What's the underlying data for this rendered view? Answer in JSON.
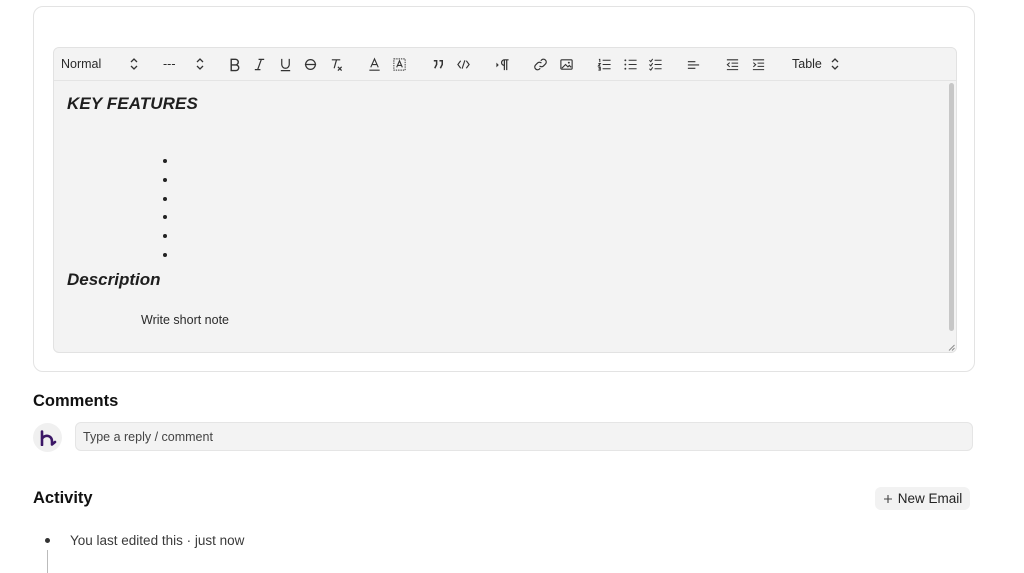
{
  "editor": {
    "toolbar": {
      "paragraph_style": "Normal",
      "font_size": "---",
      "table_label": "Table",
      "buttons": [
        "bold-icon",
        "italic-icon",
        "underline-icon",
        "strikethrough-icon",
        "clear-format-icon",
        "text-color-icon",
        "highlight-icon",
        "blockquote-icon",
        "code-icon",
        "paragraph-direction-icon",
        "link-icon",
        "image-icon",
        "ordered-list-icon",
        "bullet-list-icon",
        "checklist-icon",
        "align-left-icon",
        "outdent-icon",
        "indent-icon"
      ]
    },
    "heading_1": "KEY FEATURES",
    "bullet_count": 6,
    "heading_2": "Description",
    "note": "Write short note"
  },
  "comments": {
    "title": "Comments",
    "placeholder": "Type a reply / comment"
  },
  "activity": {
    "title": "Activity",
    "new_email_label": "New Email",
    "entries": [
      {
        "text": "You last edited this · just now"
      }
    ]
  },
  "colors": {
    "editor_bg": "#f3f3f3",
    "avatar_brand": "#3b1766"
  }
}
